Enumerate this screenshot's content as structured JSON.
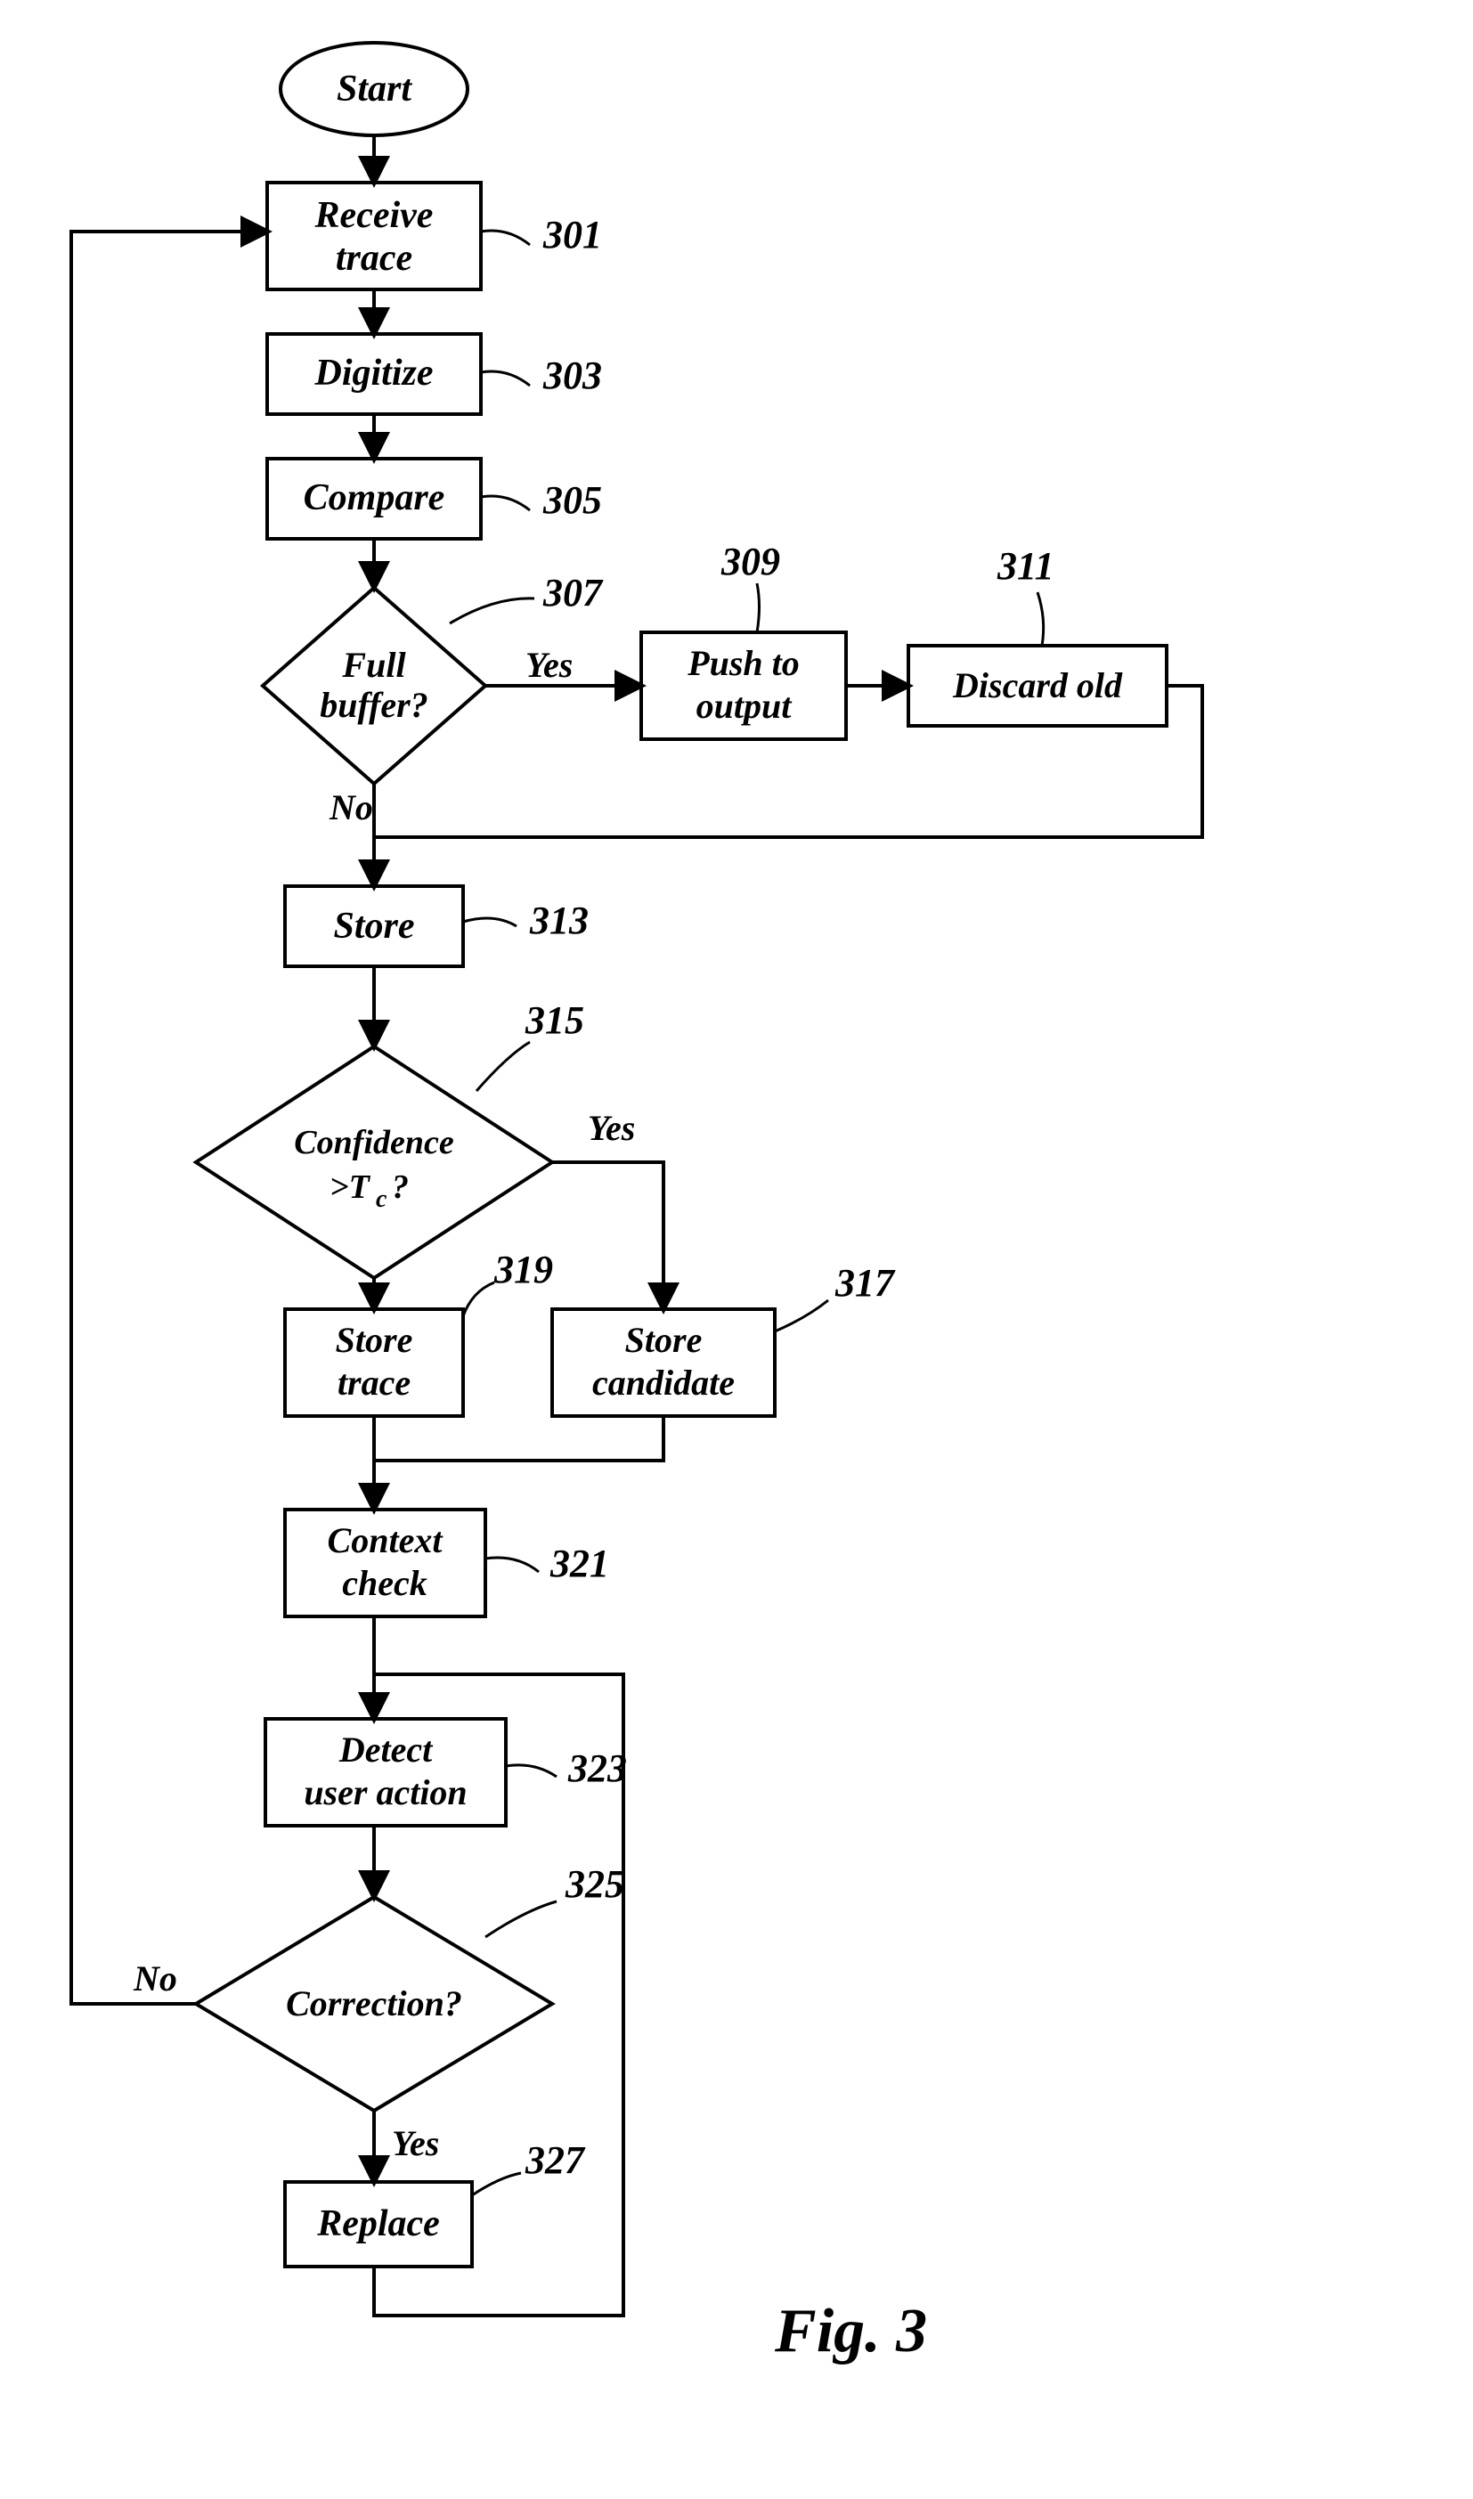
{
  "caption": "Fig. 3",
  "nodes": {
    "start": "Start",
    "receive1": "Receive",
    "receive2": "trace",
    "digitize": "Digitize",
    "compare": "Compare",
    "fullbuf1": "Full",
    "fullbuf2": "buffer?",
    "push1": "Push to",
    "push2": "output",
    "discard": "Discard old",
    "store": "Store",
    "conf1": "Confidence",
    "conf2": ">T",
    "conf3": "c",
    "conf4": " ?",
    "storetrace1": "Store",
    "storetrace2": "trace",
    "storecand1": "Store",
    "storecand2": "candidate",
    "context1": "Context",
    "context2": "check",
    "detect1": "Detect",
    "detect2": "user action",
    "correction": "Correction?",
    "replace": "Replace"
  },
  "edges": {
    "yes": "Yes",
    "no": "No"
  },
  "refs": {
    "r301": "301",
    "r303": "303",
    "r305": "305",
    "r307": "307",
    "r309": "309",
    "r311": "311",
    "r313": "313",
    "r315": "315",
    "r317": "317",
    "r319": "319",
    "r321": "321",
    "r323": "323",
    "r325": "325",
    "r327": "327"
  }
}
